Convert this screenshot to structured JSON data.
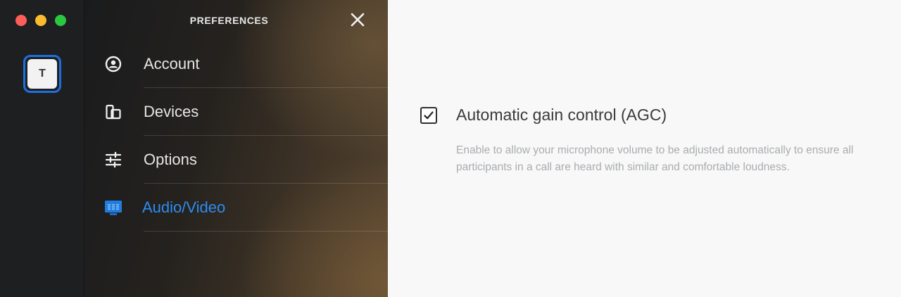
{
  "window": {
    "traffic_lights": [
      "close",
      "minimize",
      "maximize"
    ],
    "colors": {
      "close": "#fc5f57",
      "minimize": "#fdbc2e",
      "maximize": "#29c840"
    }
  },
  "rail": {
    "team_initial": "T",
    "selected_border_color": "#1d6fe0"
  },
  "preferences": {
    "title": "PREFERENCES",
    "close_icon": "close-icon",
    "menu": [
      {
        "label": "Account",
        "icon": "account-icon",
        "active": false
      },
      {
        "label": "Devices",
        "icon": "devices-icon",
        "active": false
      },
      {
        "label": "Options",
        "icon": "options-icon",
        "active": false
      },
      {
        "label": "Audio/Video",
        "icon": "audio-video-icon",
        "active": true
      }
    ],
    "active_color": "#2d8cf0"
  },
  "content": {
    "agc": {
      "checked": true,
      "title": "Automatic gain control (AGC)",
      "description": "Enable to allow your microphone volume to be adjusted automatically to ensure all participants in a call are heard with similar and comfortable loudness."
    }
  }
}
